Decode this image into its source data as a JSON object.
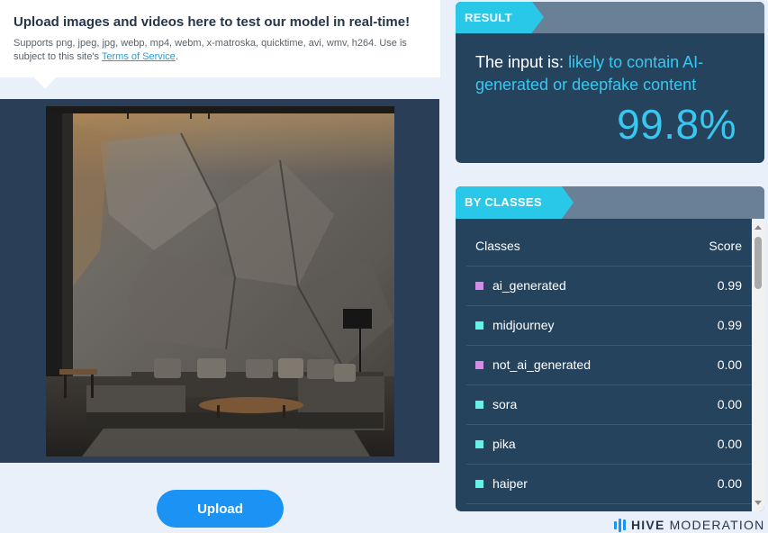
{
  "upload_info": {
    "title": "Upload images and videos here to test our model in real-time!",
    "text_before_link": "Supports png, jpeg, jpg, webp, mp4, webm, x-matroska, quicktime, avi, wmv, h264. Use is subject to this site's ",
    "link_text": "Terms of Service",
    "text_after_link": "."
  },
  "upload_button": {
    "label": "Upload"
  },
  "result": {
    "tag": "RESULT",
    "prefix": "The input is: ",
    "verdict": "likely to contain AI-generated or deepfake content",
    "percent": "99.8%"
  },
  "classes": {
    "tag": "BY CLASSES",
    "header_class": "Classes",
    "header_score": "Score",
    "rows": [
      {
        "name": "ai_generated",
        "score": "0.99",
        "color": "#d58ce6"
      },
      {
        "name": "midjourney",
        "score": "0.99",
        "color": "#67f0e6"
      },
      {
        "name": "not_ai_generated",
        "score": "0.00",
        "color": "#d58ce6"
      },
      {
        "name": "sora",
        "score": "0.00",
        "color": "#67f0e6"
      },
      {
        "name": "pika",
        "score": "0.00",
        "color": "#67f0e6"
      },
      {
        "name": "haiper",
        "score": "0.00",
        "color": "#67f0e6"
      }
    ]
  },
  "logo": {
    "bold": "HIVE",
    "rest": " MODERATION"
  }
}
